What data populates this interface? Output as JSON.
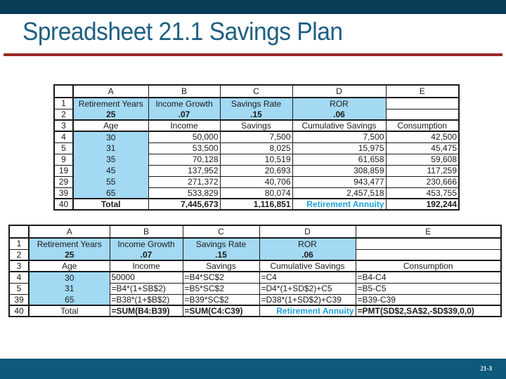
{
  "slide": {
    "title": "Spreadsheet 21.1 Savings Plan",
    "page_number": "21-3"
  },
  "colors": {
    "header_bar": "#0b3d58",
    "title_text": "#1e5f82",
    "title_rule": "#9b2a26",
    "footer_bar": "#0e5a7c",
    "input_fill": "#a3d9f3",
    "annuity_text": "#1aa0d8"
  },
  "values_table": {
    "columns": [
      "A",
      "B",
      "C",
      "D",
      "E"
    ],
    "params": {
      "row_labels": [
        "1",
        "2"
      ],
      "labels": [
        "Retirement Years",
        "Income Growth",
        "Savings Rate",
        "ROR",
        ""
      ],
      "values": [
        "25",
        ".07",
        ".15",
        ".06",
        ""
      ]
    },
    "header_row": {
      "row_label": "3",
      "cells": [
        "Age",
        "Income",
        "Savings",
        "Cumulative Savings",
        "Consumption"
      ]
    },
    "rows": [
      {
        "row": "4",
        "cells": [
          "30",
          "50,000",
          "7,500",
          "7,500",
          "42,500"
        ]
      },
      {
        "row": "5",
        "cells": [
          "31",
          "53,500",
          "8,025",
          "15,975",
          "45,475"
        ]
      },
      {
        "row": "9",
        "cells": [
          "35",
          "70,128",
          "10,519",
          "61,658",
          "59,608"
        ]
      },
      {
        "row": "19",
        "cells": [
          "45",
          "137,952",
          "20,693",
          "308,859",
          "117,259"
        ]
      },
      {
        "row": "29",
        "cells": [
          "55",
          "271,372",
          "40,706",
          "943,477",
          "230,666"
        ]
      },
      {
        "row": "39",
        "cells": [
          "65",
          "533,829",
          "80,074",
          "2,457,518",
          "453,755"
        ]
      }
    ],
    "total_row": {
      "row": "40",
      "cells": [
        "Total",
        "7,445,673",
        "1,116,851",
        "Retirement Annuity",
        "192,244"
      ]
    }
  },
  "formula_table": {
    "columns": [
      "A",
      "B",
      "C",
      "D",
      "E"
    ],
    "params": {
      "row_labels": [
        "1",
        "2"
      ],
      "labels": [
        "Retirement Years",
        "Income Growth",
        "Savings Rate",
        "ROR",
        ""
      ],
      "values": [
        "25",
        ".07",
        ".15",
        ".06",
        ""
      ]
    },
    "header_row": {
      "row_label": "3",
      "cells": [
        "Age",
        "Income",
        "Savings",
        "Cumulative Savings",
        "Consumption"
      ]
    },
    "rows": [
      {
        "row": "4",
        "cells": [
          "30",
          "50000",
          "=B4*SC$2",
          "=C4",
          "=B4-C4"
        ]
      },
      {
        "row": "5",
        "cells": [
          "31",
          "=B4*(1+SB$2)",
          "=B5*SC$2",
          "=D4*(1+SD$2)+C5",
          "=B5-C5"
        ]
      },
      {
        "row": "39",
        "cells": [
          "65",
          "=B38*(1+$B$2)",
          "=B39*SC$2",
          "=D38*(1+SD$2)+C39",
          "=B39-C39"
        ]
      }
    ],
    "total_row": {
      "row": "40",
      "cells": [
        "Total",
        "=SUM(B4:B39)",
        "=SUM(C4:C39)",
        "Retirement Annuity",
        "=PMT(SD$2,SA$2,-$D$39,0,0)"
      ]
    }
  }
}
